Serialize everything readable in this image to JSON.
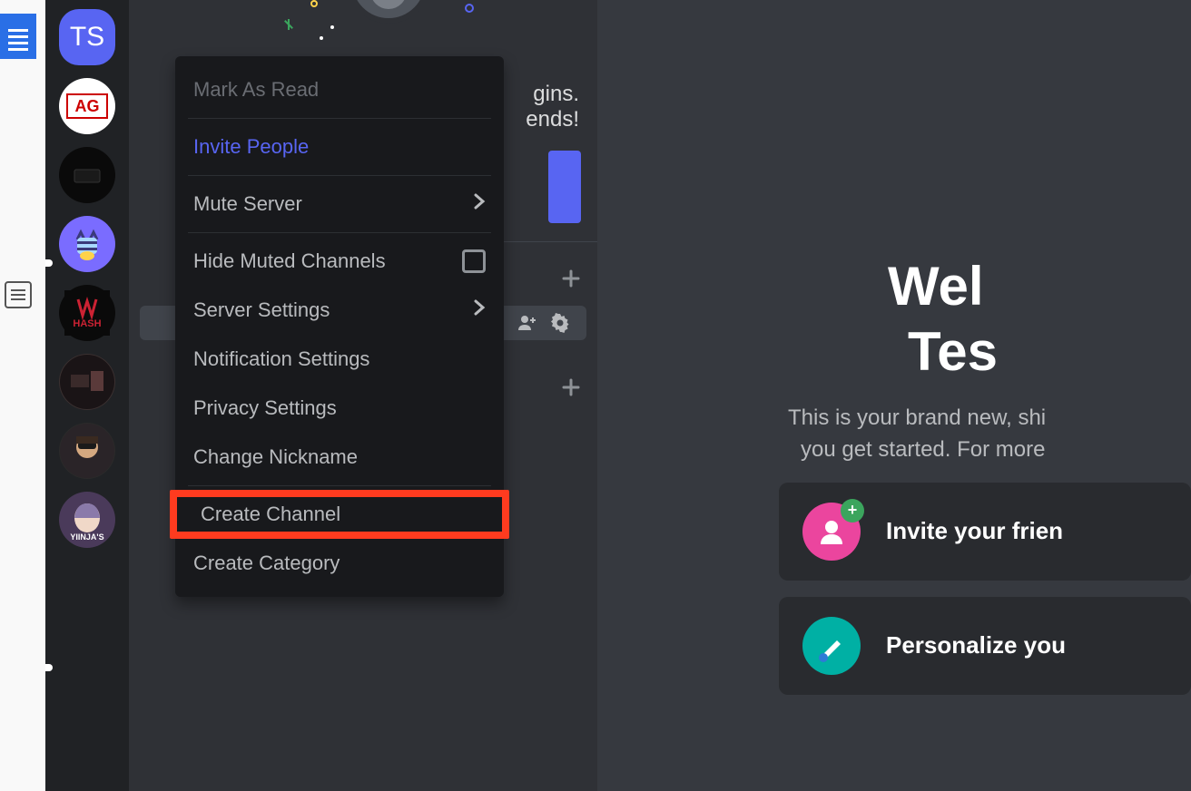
{
  "servers": {
    "ts_label": "TS",
    "ag_label": "AG"
  },
  "context_menu": {
    "mark_as_read": "Mark As Read",
    "invite_people": "Invite People",
    "mute_server": "Mute Server",
    "hide_muted": "Hide Muted Channels",
    "server_settings": "Server Settings",
    "notification_settings": "Notification Settings",
    "privacy_settings": "Privacy Settings",
    "change_nickname": "Change Nickname",
    "create_channel": "Create Channel",
    "create_category": "Create Category"
  },
  "channel_panel": {
    "line1_suffix": "gins.",
    "line2_suffix": "ends!"
  },
  "main": {
    "welcome_line1": "Wel",
    "welcome_line2": "Tes",
    "subtitle_line1": "This is your brand new, shi",
    "subtitle_line2": "you get started. For more",
    "card_invite": "Invite your frien",
    "card_personalize": "Personalize you"
  }
}
